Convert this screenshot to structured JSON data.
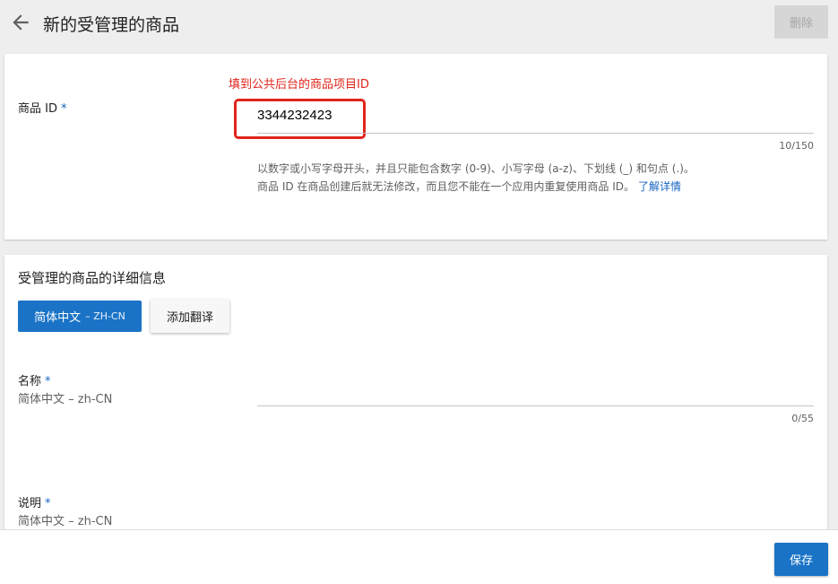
{
  "header": {
    "title": "新的受管理的商品",
    "delete_label": "删除"
  },
  "product_id_section": {
    "label": "商品 ID",
    "required_mark": "*",
    "annotation": "填到公共后台的商品项目ID",
    "value": "3344232423",
    "counter": "10/150",
    "help_line1": "以数字或小写字母开头，并且只能包含数字 (0-9)、小写字母 (a-z)、下划线 (_) 和句点 (.)。",
    "help_line2": "商品 ID 在商品创建后就无法修改，而且您不能在一个应用内重复使用商品 ID。",
    "help_link": "了解详情",
    "annotation_color": "#e0251b"
  },
  "details_section": {
    "title": "受管理的商品的详细信息",
    "language_tab": {
      "label": "简体中文",
      "code": "– ZH-CN"
    },
    "add_translation_label": "添加翻译",
    "name_field": {
      "label": "名称",
      "required_mark": "*",
      "sublabel": "简体中文 – zh-CN",
      "value": "",
      "counter": "0/55"
    },
    "description_field": {
      "label": "说明",
      "required_mark": "*",
      "sublabel": "简体中文 – zh-CN",
      "value": ""
    }
  },
  "footer": {
    "save_label": "保存"
  },
  "colors": {
    "primary": "#1a73c6",
    "required": "#1565c0",
    "annotation": "#e0251b"
  },
  "icons": {
    "back": "arrow-back-icon"
  }
}
